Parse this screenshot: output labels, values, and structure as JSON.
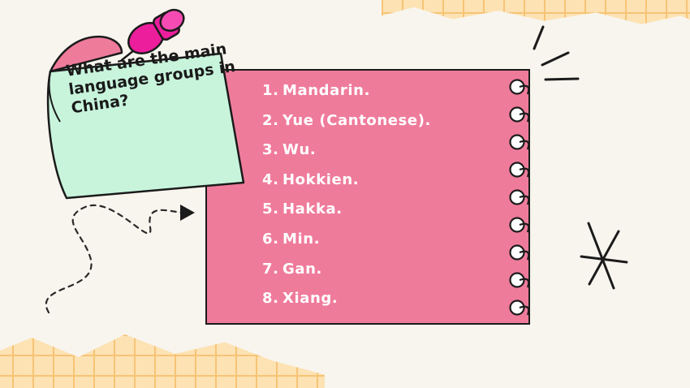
{
  "note": {
    "question": "What are the main language groups in China?"
  },
  "list": {
    "items": [
      {
        "number": "1.",
        "text": "Mandarin."
      },
      {
        "number": "2.",
        "text": "Yue (Cantonese)."
      },
      {
        "number": "3.",
        "text": "Wu."
      },
      {
        "number": "4.",
        "text": "Hokkien."
      },
      {
        "number": "5.",
        "text": "Hakka."
      },
      {
        "number": "6.",
        "text": "Min."
      },
      {
        "number": "7.",
        "text": "Gan."
      },
      {
        "number": "8.",
        "text": "Xiang."
      }
    ]
  },
  "colors": {
    "background": "#f8f5ee",
    "notebook": "#ef7b9b",
    "sticky_note": "#c8f4dc",
    "pin": "#ec1e9c",
    "grid": "#fde2b3"
  },
  "icons": [
    "pushpin-icon",
    "spiral-ring-icon",
    "burst-lines-icon",
    "asterisk-icon",
    "dashed-arrow-icon"
  ]
}
